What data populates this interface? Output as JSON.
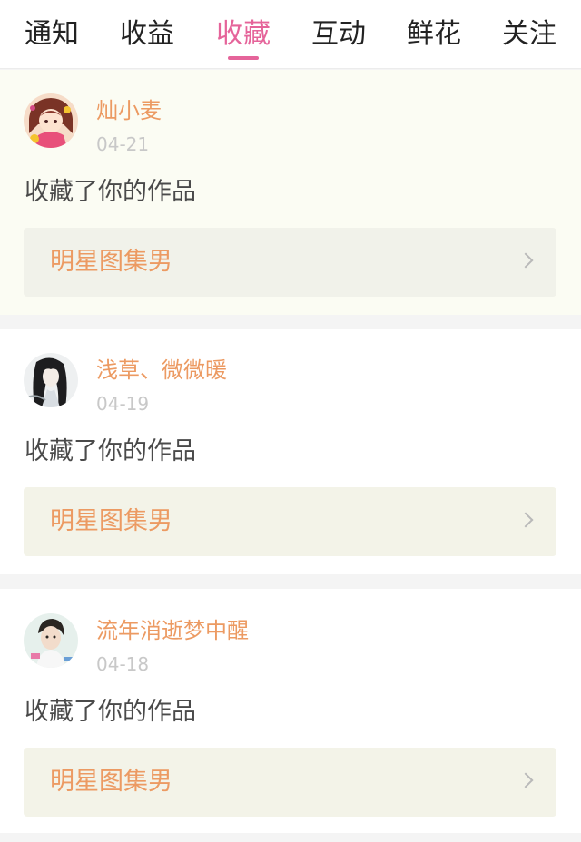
{
  "tabs": [
    {
      "label": "通知",
      "active": false
    },
    {
      "label": "收益",
      "active": false
    },
    {
      "label": "收藏",
      "active": true
    },
    {
      "label": "互动",
      "active": false
    },
    {
      "label": "鲜花",
      "active": false
    },
    {
      "label": "关注",
      "active": false
    }
  ],
  "colors": {
    "accent": "#e5649a",
    "username": "#ec9a62",
    "work_title": "#ec9a62",
    "date": "#c8c8c8",
    "action": "#4a4a4a"
  },
  "notifications": [
    {
      "avatar_icon": "anime-girl-avatar-icon",
      "username": "灿小麦",
      "date": "04-21",
      "action": "收藏了你的作品",
      "work_title": "明星图集男"
    },
    {
      "avatar_icon": "ink-painting-girl-avatar-icon",
      "username": "浅草、微微暖",
      "date": "04-19",
      "action": "收藏了你的作品",
      "work_title": "明星图集男"
    },
    {
      "avatar_icon": "celebrity-photo-avatar-icon",
      "username": "流年消逝梦中醒",
      "date": "04-18",
      "action": "收藏了你的作品",
      "work_title": "明星图集男"
    }
  ]
}
